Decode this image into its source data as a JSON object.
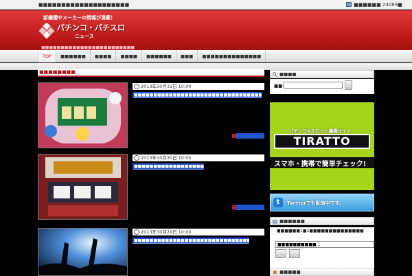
{
  "topbar": {
    "tagline": "■■■■■■■■■■■■■■■■■■■■",
    "rss": "■■■■■■ 24089■"
  },
  "header": {
    "catch": "新機種やメーカーの情報が満載！",
    "site_name": "パチンコ・パチスロ",
    "site_name_sub": "ニュース",
    "description": "■■■■■■■■■■■■■■■■■■■■■■■■"
  },
  "nav": {
    "items": [
      "TOP",
      "■■■■■■",
      "■■■■",
      "■■■■",
      "■■■■■■",
      "■■■",
      "■■■■■■■■■■■■■■"
    ]
  },
  "section_title": "■■■■■■■■",
  "posts": [
    {
      "date": "2013年10月31日 10:00",
      "title": "■■■■■■■■■■■■■■■■■■■■■■■■■■■■■■■■■■■■■■■■■■■■"
    },
    {
      "date": "2013年10月30日 10:00",
      "title": "■■■■■■■■■■■■■■■■■■■■■■■■■■■■■"
    },
    {
      "date": "2013年10月29日 10:00",
      "title": "■■■■■■■■■■■■■■■■■■■■■■■■■■■■■■■■■■■■■■■■■■■■■"
    }
  ],
  "sidebar": {
    "search_head": "■■■■",
    "search_label": "■■:",
    "banner_sub": "パチンコ&スロット機種サイト",
    "banner_logo": "TIRATTO",
    "banner_cta": "スマホ・携帯で簡単チェック!",
    "twitter_text": "Twitterでも配信中です。",
    "ranking_head": "■■■■■■",
    "ranking_text": "■■■■■■1■2■■■■■■■■■■■■■■",
    "ranking_value": "■■■■■■■■■■...",
    "bottom_head": "■■■■■"
  },
  "colors": {
    "header_red": "#c11d1d",
    "link_blue": "#2255cc",
    "banner_green": "#a6d41a"
  }
}
